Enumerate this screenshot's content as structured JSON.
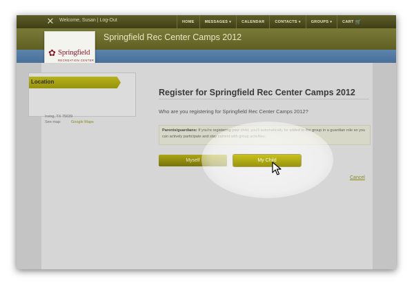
{
  "topbar": {
    "welcome_prefix": "Welcome, Susan |",
    "logout_label": "Log-Out",
    "nav": [
      {
        "label": "HOME"
      },
      {
        "label": "MESSAGES",
        "caret": "▾"
      },
      {
        "label": "CALENDAR"
      },
      {
        "label": "CONTACTS",
        "caret": "▾"
      },
      {
        "label": "GROUPS",
        "caret": "▾"
      },
      {
        "label": "CART",
        "icon": "cart-icon"
      }
    ]
  },
  "banner": {
    "title": "Springfield Rec Center Camps 2012"
  },
  "logo": {
    "name": "Springfield",
    "subtitle": "RECREATION CENTER",
    "icon": "flower-logo-icon"
  },
  "location": {
    "title": "Location",
    "city": "Irving, TX 75039",
    "map_prefix": "See map:",
    "map_link": "Google Maps"
  },
  "register": {
    "title": "Register for Springfield Rec Center Camps 2012",
    "question": "Who are you registering for Springfield Rec Center Camps 2012?",
    "info_label": "Parents/guardians:",
    "info_text": "If you're registering your child, you'll automatically be added to the group in a guardian role so you can actively participate and stay current with group activities.",
    "myself_label": "Myself",
    "child_label": "My Child",
    "cancel_label": "Cancel"
  },
  "colors": {
    "topbar": "#4a4a1c",
    "banner": "#6c6c2c",
    "accent": "#b3ad18",
    "stripe": "#527aa3",
    "logo": "#8b1a2b"
  }
}
